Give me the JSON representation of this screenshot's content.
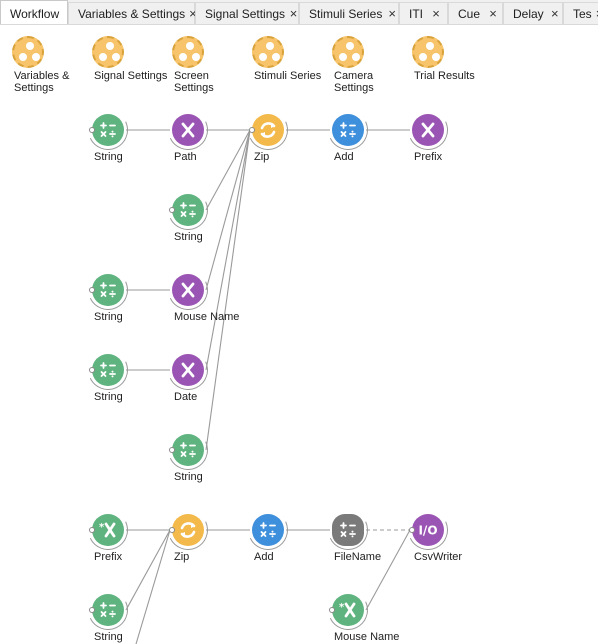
{
  "tabs": [
    {
      "label": "Workflow",
      "closable": false,
      "active": true
    },
    {
      "label": "Variables & Settings",
      "closable": true
    },
    {
      "label": "Signal Settings",
      "closable": true
    },
    {
      "label": "Stimuli Series",
      "closable": true
    },
    {
      "label": "ITI",
      "closable": true
    },
    {
      "label": "Cue",
      "closable": true
    },
    {
      "label": "Delay",
      "closable": true
    },
    {
      "label": "Tes",
      "closable": true
    }
  ],
  "icons": {
    "close": "×",
    "group": "group-workflow-icon",
    "string": "calculator-icon",
    "property": "x-property-icon",
    "zip": "zip-icon",
    "add": "calculator-icon",
    "filename": "gear-calculator-icon",
    "csvwriter": "io-icon"
  },
  "colors": {
    "string_node": "#5fb37e",
    "property_node": "#9a55b4",
    "zip_node": "#f3b94b",
    "add_node": "#3e8fdc",
    "filename_node": "#7a7a7a",
    "group_node": "#f7c46b",
    "edge": "#9a9a9a"
  },
  "groups": [
    {
      "id": "var",
      "label": "Variables &\nSettings"
    },
    {
      "id": "sig",
      "label": "Signal Settings"
    },
    {
      "id": "scr",
      "label": "Screen\nSettings"
    },
    {
      "id": "stim",
      "label": "Stimuli Series"
    },
    {
      "id": "cam",
      "label": "Camera\nSettings"
    },
    {
      "id": "trial",
      "label": "Trial Results"
    }
  ],
  "nodes": [
    {
      "id": "s1",
      "kind": "string",
      "label": "String"
    },
    {
      "id": "path",
      "kind": "property",
      "label": "Path"
    },
    {
      "id": "zip1",
      "kind": "zip",
      "label": "Zip"
    },
    {
      "id": "add1",
      "kind": "add",
      "label": "Add"
    },
    {
      "id": "prefix1",
      "kind": "property",
      "label": "Prefix"
    },
    {
      "id": "s2",
      "kind": "string",
      "label": "String"
    },
    {
      "id": "s3",
      "kind": "string",
      "label": "String"
    },
    {
      "id": "mouse",
      "kind": "property",
      "label": "Mouse Name"
    },
    {
      "id": "s4",
      "kind": "string",
      "label": "String"
    },
    {
      "id": "date",
      "kind": "property",
      "label": "Date"
    },
    {
      "id": "s5",
      "kind": "string",
      "label": "String"
    },
    {
      "id": "prefix2",
      "kind": "external",
      "label": "Prefix"
    },
    {
      "id": "zip2",
      "kind": "zip",
      "label": "Zip"
    },
    {
      "id": "add2",
      "kind": "add",
      "label": "Add"
    },
    {
      "id": "filename",
      "kind": "filename",
      "label": "FileName"
    },
    {
      "id": "csv",
      "kind": "csvwriter",
      "label": "CsvWriter"
    },
    {
      "id": "s6",
      "kind": "string",
      "label": "String"
    },
    {
      "id": "mouse2",
      "kind": "external",
      "label": "Mouse Name"
    }
  ],
  "edges": [
    [
      "s1",
      "path"
    ],
    [
      "path",
      "zip1"
    ],
    [
      "zip1",
      "add1"
    ],
    [
      "add1",
      "prefix1"
    ],
    [
      "s2",
      "zip1"
    ],
    [
      "mouse",
      "zip1"
    ],
    [
      "date",
      "zip1"
    ],
    [
      "s5",
      "zip1"
    ],
    [
      "s3",
      "mouse"
    ],
    [
      "s4",
      "date"
    ],
    [
      "prefix2",
      "zip2"
    ],
    [
      "zip2",
      "add2"
    ],
    [
      "add2",
      "filename"
    ],
    [
      "s6",
      "zip2"
    ],
    [
      "mouse2",
      "csv"
    ]
  ],
  "dashed_edges": [
    [
      "filename",
      "csv"
    ]
  ]
}
